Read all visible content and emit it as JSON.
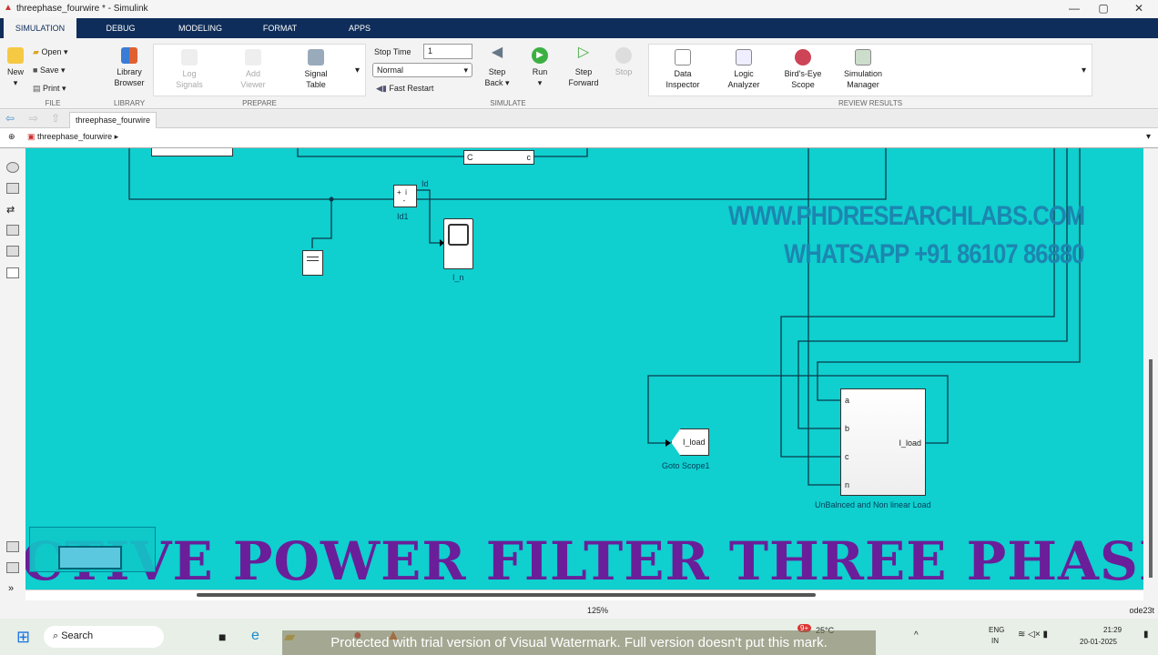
{
  "window": {
    "title": "threephase_fourwire * - Simulink",
    "minimize": "—",
    "maximize": "▢",
    "close": "✕"
  },
  "tabs": [
    "SIMULATION",
    "DEBUG",
    "MODELING",
    "FORMAT",
    "APPS"
  ],
  "ribbon": {
    "file": {
      "new": "New",
      "open": "Open",
      "save": "Save",
      "print": "Print",
      "group": "FILE"
    },
    "library": {
      "browser": "Library Browser",
      "group": "LIBRARY"
    },
    "prepare": {
      "log": "Log Signals",
      "add": "Add Viewer",
      "signal_table": "Signal Table",
      "group": "PREPARE"
    },
    "simulate": {
      "stop_time_label": "Stop Time",
      "stop_time": "1",
      "mode": "Normal",
      "fast_restart": "Fast Restart",
      "step_back": "Step Back",
      "run": "Run",
      "step_forward": "Step Forward",
      "stop": "Stop",
      "group": "SIMULATE"
    },
    "review": {
      "data_inspector": "Data Inspector",
      "logic_analyzer": "Logic Analyzer",
      "birds_eye": "Bird's-Eye Scope",
      "sim_manager": "Simulation Manager",
      "group": "REVIEW RESULTS"
    }
  },
  "model_tab": "threephase_fourwire",
  "breadcrumb": "threephase_fourwire",
  "diagram": {
    "c_block_in": "C",
    "c_block_out": "c",
    "id_signal": "Id",
    "id_block": "Id1",
    "scope": "I_n",
    "goto_tag": "I_load",
    "goto_label": "Goto Scope1",
    "load_ports": [
      "a",
      "b",
      "c",
      "n"
    ],
    "load_out": "I_load",
    "load_label": "UnBalnced and Non linear  Load",
    "watermark1": "WWW.PHDRESEARCHLABS.COM",
    "watermark2": "WHATSAPP +91 86107 86880",
    "banner": "CTIVE POWER FILTER THREE PHASE FO"
  },
  "status": {
    "zoom": "125%",
    "solver": "ode23t"
  },
  "taskbar": {
    "search": "Search",
    "weather_temp": "25°C",
    "weather_badge": "9+",
    "lang1": "ENG",
    "lang2": "IN",
    "time": "21:29",
    "date": "20-01-2025",
    "watermark": "Protected with trial version of Visual Watermark. Full version doesn't put this mark."
  }
}
